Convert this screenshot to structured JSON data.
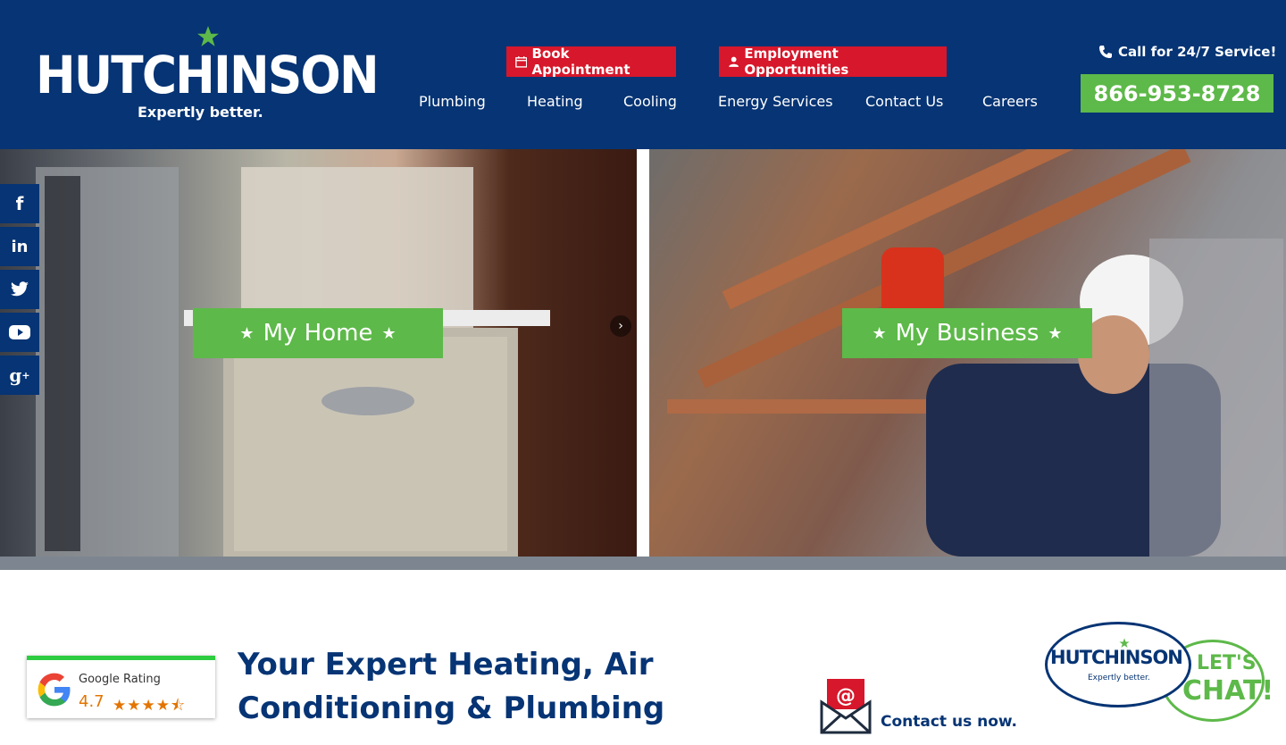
{
  "header": {
    "logo_text": "HUTCHINSON",
    "logo_tagline": "Expertly better.",
    "book_label": "Book Appointment",
    "employment_label": "Employment Opportunities",
    "nav": [
      "Plumbing",
      "Heating",
      "Cooling",
      "Energy Services",
      "Contact Us",
      "Careers"
    ],
    "service_call": "Call for 24/7 Service!",
    "phone": "866-953-8728"
  },
  "hero": {
    "home_label": "My Home",
    "business_label": "My Business"
  },
  "social": [
    "facebook-icon",
    "linkedin-icon",
    "twitter-icon",
    "youtube-icon",
    "google-plus-icon"
  ],
  "rating": {
    "label": "Google Rating",
    "score": "4.7",
    "stars": "★★★★⯪"
  },
  "main": {
    "headline": "Your Expert Heating, Air Conditioning & Plumbing"
  },
  "contact": {
    "label": "Contact us now."
  },
  "chat": {
    "brand": "HUTCHINSON",
    "tagline": "Expertly better.",
    "lets": "LET'S",
    "chat": "CHAT!"
  },
  "colors": {
    "navy": "#063474",
    "green": "#5db949",
    "red": "#d7172b"
  }
}
